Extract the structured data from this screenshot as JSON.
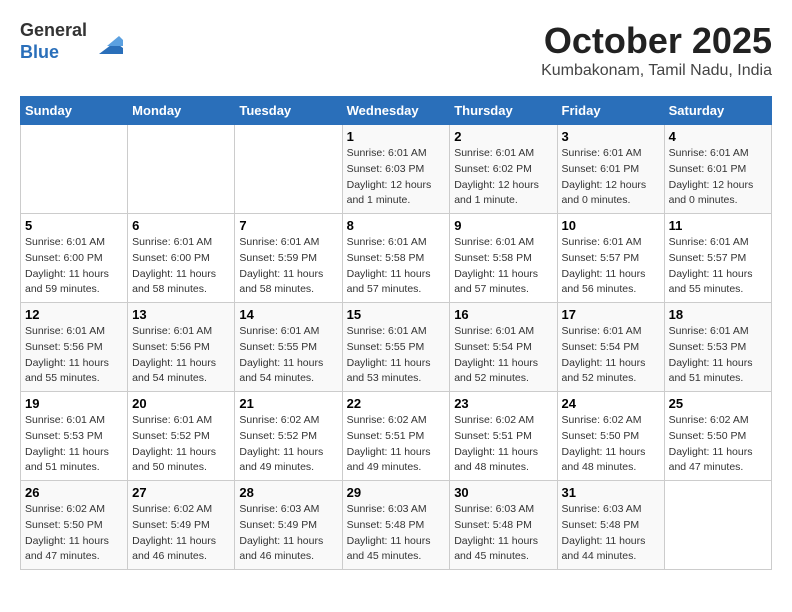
{
  "header": {
    "logo_line1": "General",
    "logo_line2": "Blue",
    "month": "October 2025",
    "location": "Kumbakonam, Tamil Nadu, India"
  },
  "weekdays": [
    "Sunday",
    "Monday",
    "Tuesday",
    "Wednesday",
    "Thursday",
    "Friday",
    "Saturday"
  ],
  "weeks": [
    [
      {
        "day": "",
        "sunrise": "",
        "sunset": "",
        "daylight": ""
      },
      {
        "day": "",
        "sunrise": "",
        "sunset": "",
        "daylight": ""
      },
      {
        "day": "",
        "sunrise": "",
        "sunset": "",
        "daylight": ""
      },
      {
        "day": "1",
        "sunrise": "Sunrise: 6:01 AM",
        "sunset": "Sunset: 6:03 PM",
        "daylight": "Daylight: 12 hours and 1 minute."
      },
      {
        "day": "2",
        "sunrise": "Sunrise: 6:01 AM",
        "sunset": "Sunset: 6:02 PM",
        "daylight": "Daylight: 12 hours and 1 minute."
      },
      {
        "day": "3",
        "sunrise": "Sunrise: 6:01 AM",
        "sunset": "Sunset: 6:01 PM",
        "daylight": "Daylight: 12 hours and 0 minutes."
      },
      {
        "day": "4",
        "sunrise": "Sunrise: 6:01 AM",
        "sunset": "Sunset: 6:01 PM",
        "daylight": "Daylight: 12 hours and 0 minutes."
      }
    ],
    [
      {
        "day": "5",
        "sunrise": "Sunrise: 6:01 AM",
        "sunset": "Sunset: 6:00 PM",
        "daylight": "Daylight: 11 hours and 59 minutes."
      },
      {
        "day": "6",
        "sunrise": "Sunrise: 6:01 AM",
        "sunset": "Sunset: 6:00 PM",
        "daylight": "Daylight: 11 hours and 58 minutes."
      },
      {
        "day": "7",
        "sunrise": "Sunrise: 6:01 AM",
        "sunset": "Sunset: 5:59 PM",
        "daylight": "Daylight: 11 hours and 58 minutes."
      },
      {
        "day": "8",
        "sunrise": "Sunrise: 6:01 AM",
        "sunset": "Sunset: 5:58 PM",
        "daylight": "Daylight: 11 hours and 57 minutes."
      },
      {
        "day": "9",
        "sunrise": "Sunrise: 6:01 AM",
        "sunset": "Sunset: 5:58 PM",
        "daylight": "Daylight: 11 hours and 57 minutes."
      },
      {
        "day": "10",
        "sunrise": "Sunrise: 6:01 AM",
        "sunset": "Sunset: 5:57 PM",
        "daylight": "Daylight: 11 hours and 56 minutes."
      },
      {
        "day": "11",
        "sunrise": "Sunrise: 6:01 AM",
        "sunset": "Sunset: 5:57 PM",
        "daylight": "Daylight: 11 hours and 55 minutes."
      }
    ],
    [
      {
        "day": "12",
        "sunrise": "Sunrise: 6:01 AM",
        "sunset": "Sunset: 5:56 PM",
        "daylight": "Daylight: 11 hours and 55 minutes."
      },
      {
        "day": "13",
        "sunrise": "Sunrise: 6:01 AM",
        "sunset": "Sunset: 5:56 PM",
        "daylight": "Daylight: 11 hours and 54 minutes."
      },
      {
        "day": "14",
        "sunrise": "Sunrise: 6:01 AM",
        "sunset": "Sunset: 5:55 PM",
        "daylight": "Daylight: 11 hours and 54 minutes."
      },
      {
        "day": "15",
        "sunrise": "Sunrise: 6:01 AM",
        "sunset": "Sunset: 5:55 PM",
        "daylight": "Daylight: 11 hours and 53 minutes."
      },
      {
        "day": "16",
        "sunrise": "Sunrise: 6:01 AM",
        "sunset": "Sunset: 5:54 PM",
        "daylight": "Daylight: 11 hours and 52 minutes."
      },
      {
        "day": "17",
        "sunrise": "Sunrise: 6:01 AM",
        "sunset": "Sunset: 5:54 PM",
        "daylight": "Daylight: 11 hours and 52 minutes."
      },
      {
        "day": "18",
        "sunrise": "Sunrise: 6:01 AM",
        "sunset": "Sunset: 5:53 PM",
        "daylight": "Daylight: 11 hours and 51 minutes."
      }
    ],
    [
      {
        "day": "19",
        "sunrise": "Sunrise: 6:01 AM",
        "sunset": "Sunset: 5:53 PM",
        "daylight": "Daylight: 11 hours and 51 minutes."
      },
      {
        "day": "20",
        "sunrise": "Sunrise: 6:01 AM",
        "sunset": "Sunset: 5:52 PM",
        "daylight": "Daylight: 11 hours and 50 minutes."
      },
      {
        "day": "21",
        "sunrise": "Sunrise: 6:02 AM",
        "sunset": "Sunset: 5:52 PM",
        "daylight": "Daylight: 11 hours and 49 minutes."
      },
      {
        "day": "22",
        "sunrise": "Sunrise: 6:02 AM",
        "sunset": "Sunset: 5:51 PM",
        "daylight": "Daylight: 11 hours and 49 minutes."
      },
      {
        "day": "23",
        "sunrise": "Sunrise: 6:02 AM",
        "sunset": "Sunset: 5:51 PM",
        "daylight": "Daylight: 11 hours and 48 minutes."
      },
      {
        "day": "24",
        "sunrise": "Sunrise: 6:02 AM",
        "sunset": "Sunset: 5:50 PM",
        "daylight": "Daylight: 11 hours and 48 minutes."
      },
      {
        "day": "25",
        "sunrise": "Sunrise: 6:02 AM",
        "sunset": "Sunset: 5:50 PM",
        "daylight": "Daylight: 11 hours and 47 minutes."
      }
    ],
    [
      {
        "day": "26",
        "sunrise": "Sunrise: 6:02 AM",
        "sunset": "Sunset: 5:50 PM",
        "daylight": "Daylight: 11 hours and 47 minutes."
      },
      {
        "day": "27",
        "sunrise": "Sunrise: 6:02 AM",
        "sunset": "Sunset: 5:49 PM",
        "daylight": "Daylight: 11 hours and 46 minutes."
      },
      {
        "day": "28",
        "sunrise": "Sunrise: 6:03 AM",
        "sunset": "Sunset: 5:49 PM",
        "daylight": "Daylight: 11 hours and 46 minutes."
      },
      {
        "day": "29",
        "sunrise": "Sunrise: 6:03 AM",
        "sunset": "Sunset: 5:48 PM",
        "daylight": "Daylight: 11 hours and 45 minutes."
      },
      {
        "day": "30",
        "sunrise": "Sunrise: 6:03 AM",
        "sunset": "Sunset: 5:48 PM",
        "daylight": "Daylight: 11 hours and 45 minutes."
      },
      {
        "day": "31",
        "sunrise": "Sunrise: 6:03 AM",
        "sunset": "Sunset: 5:48 PM",
        "daylight": "Daylight: 11 hours and 44 minutes."
      },
      {
        "day": "",
        "sunrise": "",
        "sunset": "",
        "daylight": ""
      }
    ]
  ]
}
